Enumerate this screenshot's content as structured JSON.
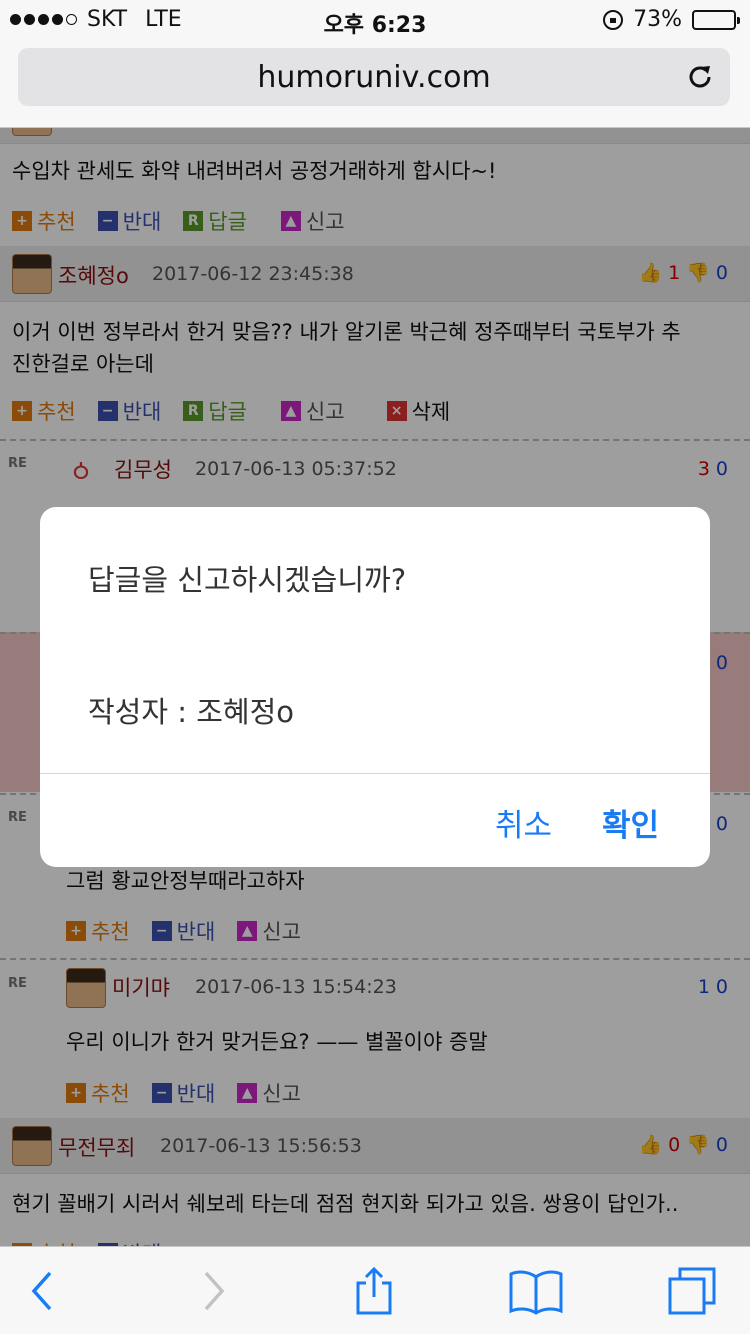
{
  "status": {
    "carrier": "SKT",
    "network": "LTE",
    "time": "오후 6:23",
    "battery": "73%",
    "battery_level": 0.73
  },
  "browser": {
    "url": "humoruniv.com"
  },
  "comments": [
    {
      "text": "수입차 관세도 화약 내려버려서 공정거래하게 합시다~!"
    },
    {
      "author": "조혜정o",
      "datetime": "2017-06-12 23:45:38",
      "likes": "1",
      "dislikes": "0",
      "text_line1": "이거 이번 정부라서 한거 맞음?? 내가 알기론 박근혜 정주때부터 국토부가 추",
      "text_line2": "진한걸로 아는데"
    },
    {
      "author": "김무성",
      "datetime": "2017-06-13 05:37:52",
      "likes": "3",
      "dislikes": "0"
    },
    {
      "likes": "0"
    },
    {
      "dislikes": "0",
      "text": "그럼 황교안정부때라고하자"
    },
    {
      "author": "미기먀",
      "datetime": "2017-06-13 15:54:23",
      "likes": "1",
      "dislikes": "0",
      "text": "우리 이니가 한거 맞거든요? —— 별꼴이야 증말"
    },
    {
      "author": "무전무죄",
      "datetime": "2017-06-13 15:56:53",
      "likes": "0",
      "dislikes": "0",
      "text": "현기 꼴배기 시러서 쉐보레 타는데 점점 현지화 되가고 있음. 쌍용이 답인가.."
    }
  ],
  "actions": {
    "recommend": "추천",
    "oppose": "반대",
    "reply": "답글",
    "report": "신고",
    "delete": "삭제",
    "re": "RE"
  },
  "dialog": {
    "title": "답글을 신고하시겠습니까?",
    "message": "작성자 : 조혜정o",
    "cancel": "취소",
    "confirm": "확인"
  },
  "colors": {
    "link_blue": "#1a7cf5",
    "author_red": "#8b1010",
    "overlay": "rgba(0,0,0,0.38)"
  }
}
